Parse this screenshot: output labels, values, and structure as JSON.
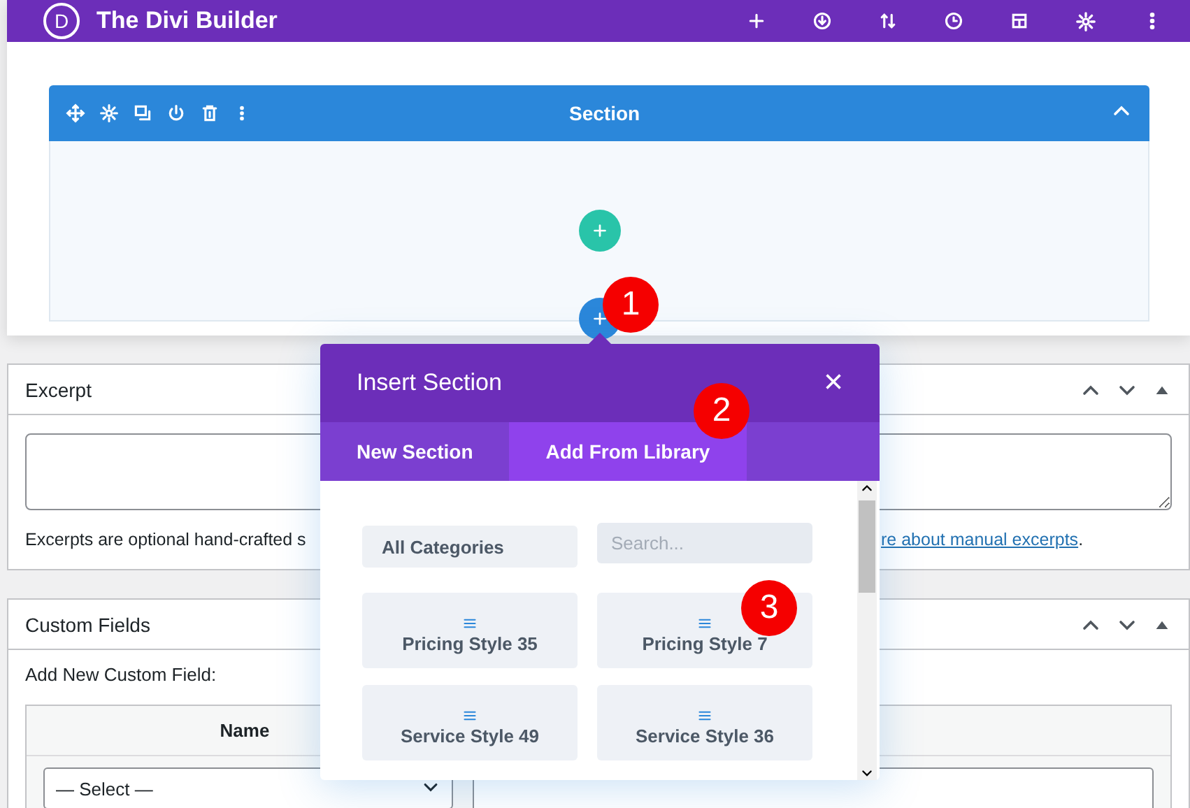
{
  "builder": {
    "logo": "D",
    "title": "The Divi Builder"
  },
  "section": {
    "title": "Section",
    "expanded": true
  },
  "excerpt": {
    "title": "Excerpt",
    "help_start": "Excerpts are optional hand-crafted s",
    "help_link": "re about manual excerpts",
    "help_end": "."
  },
  "custom_fields": {
    "title": "Custom Fields",
    "add_label": "Add New Custom Field:",
    "columns": [
      "Name"
    ],
    "select_value": "— Select —"
  },
  "modal": {
    "title": "Insert Section",
    "close": "×",
    "tabs": [
      {
        "label": "New Section",
        "selected": false
      },
      {
        "label": "Add From Library",
        "selected": true
      }
    ],
    "category": "All Categories",
    "search_placeholder": "Search...",
    "layouts": [
      {
        "name": "Pricing Style 35"
      },
      {
        "name": "Pricing Style 7"
      },
      {
        "name": "Service Style 49"
      },
      {
        "name": "Service Style 36"
      }
    ]
  },
  "annotations": [
    {
      "label": "1"
    },
    {
      "label": "2"
    },
    {
      "label": "3"
    }
  ]
}
